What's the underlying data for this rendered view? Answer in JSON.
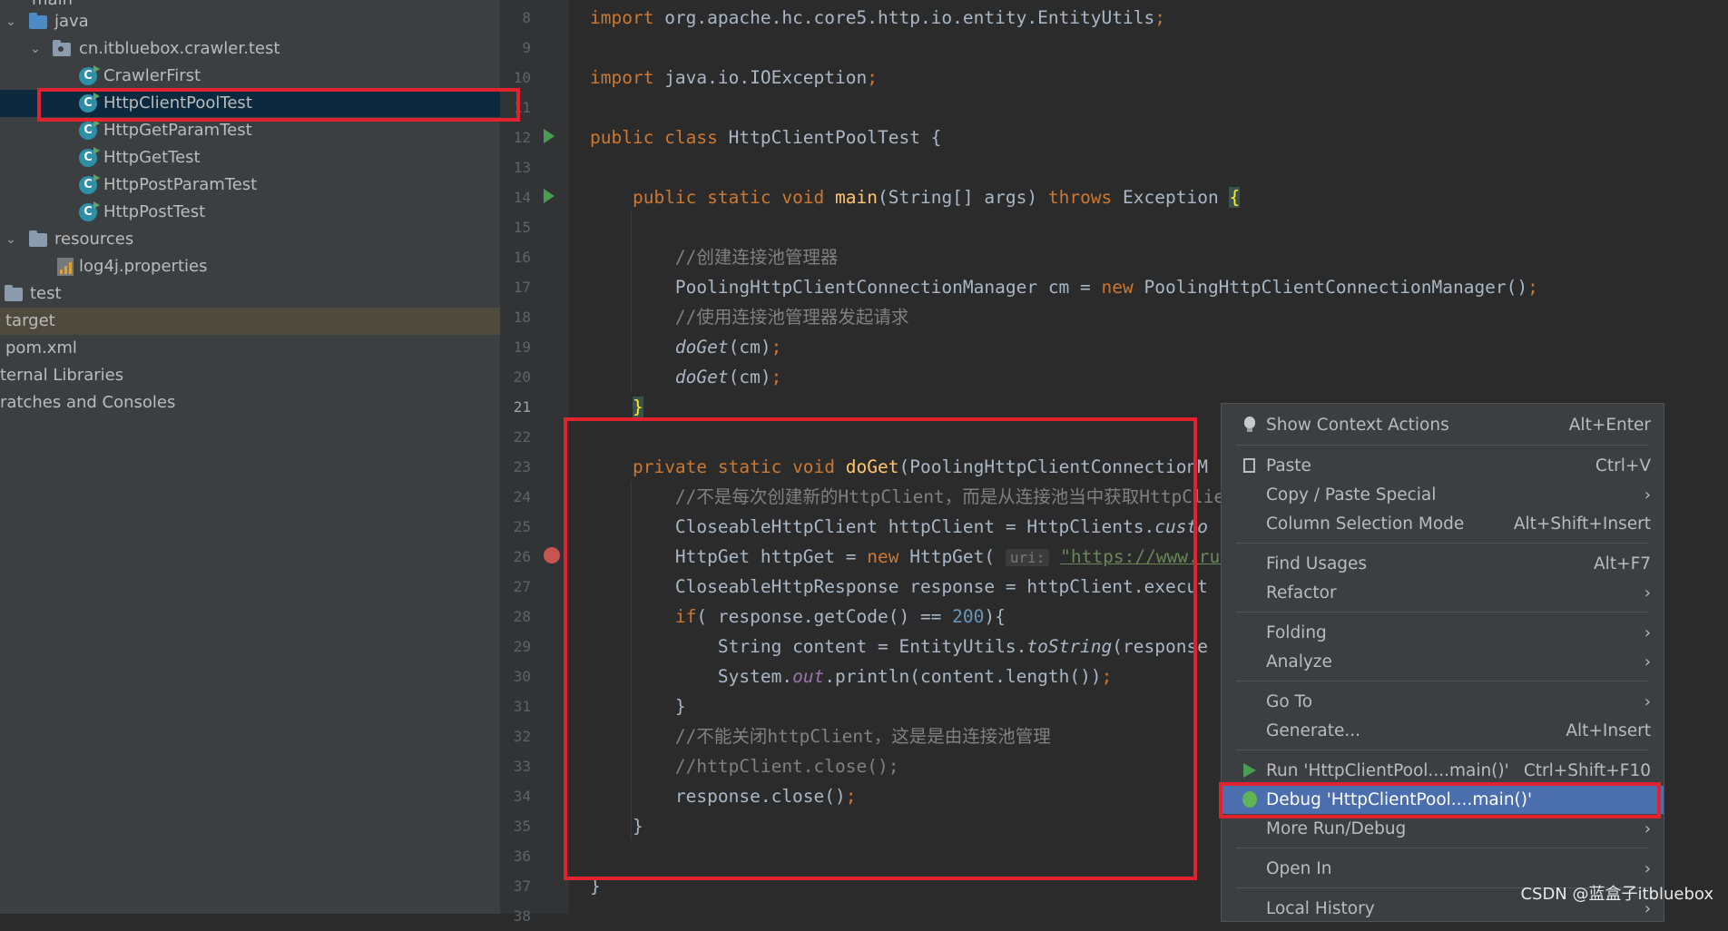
{
  "project_tree": {
    "items": [
      {
        "label": "main"
      },
      {
        "label": "java"
      },
      {
        "label": "cn.itbluebox.crawler.test"
      },
      {
        "label": "CrawlerFirst"
      },
      {
        "label": "HttpClientPoolTest"
      },
      {
        "label": "HttpGetParamTest"
      },
      {
        "label": "HttpGetTest"
      },
      {
        "label": "HttpPostParamTest"
      },
      {
        "label": "HttpPostTest"
      },
      {
        "label": "resources"
      },
      {
        "label": "log4j.properties"
      },
      {
        "label": "test"
      },
      {
        "label": "target"
      },
      {
        "label": "pom.xml"
      },
      {
        "label": "ternal Libraries"
      },
      {
        "label": "ratches and Consoles"
      }
    ]
  },
  "editor": {
    "line_numbers": [
      "8",
      "9",
      "10",
      "11",
      "12",
      "13",
      "14",
      "15",
      "16",
      "17",
      "18",
      "19",
      "20",
      "21",
      "22",
      "23",
      "24",
      "25",
      "26",
      "27",
      "28",
      "29",
      "30",
      "31",
      "32",
      "33",
      "34",
      "35",
      "36",
      "37",
      "38"
    ],
    "current_line": "21",
    "breakpoint_line": "26",
    "code": {
      "l8": {
        "kw": "import ",
        "rest": "org.apache.hc.core5.http.io.entity.EntityUtils",
        "semi": ";"
      },
      "l10": {
        "kw": "import ",
        "rest": "java.io.IOException",
        "semi": ";"
      },
      "l12": {
        "kw": "public class ",
        "rest": "HttpClientPoolTest {"
      },
      "l14": {
        "kw1": "public static void ",
        "fn": "main",
        "mid": "(String[] args) ",
        "kw2": "throws ",
        "rest": "Exception ",
        "brace": "{"
      },
      "l16": {
        "comment": "//创建连接池管理器"
      },
      "l17": {
        "a": "PoolingHttpClientConnectionManager cm = ",
        "kw": "new ",
        "b": "PoolingHttpClientConnectionManager()",
        "semi": ";"
      },
      "l18": {
        "comment": "//使用连接池管理器发起请求"
      },
      "l19": {
        "fn": "doGet",
        "rest": "(cm)",
        "semi": ";"
      },
      "l20": {
        "fn": "doGet",
        "rest": "(cm)",
        "semi": ";"
      },
      "l21": {
        "brace": "}"
      },
      "l23": {
        "kw": "private static void ",
        "fn": "doGet",
        "rest": "(PoolingHttpClientConnectionM"
      },
      "l24": {
        "comment": "//不是每次创建新的HttpClient，而是从连接池当中获取HttpClie"
      },
      "l25": {
        "a": "CloseableHttpClient httpClient = HttpClients.",
        "it": "custo"
      },
      "l26": {
        "a": "HttpGet httpGet = ",
        "kw": "new ",
        "b": "HttpGet( ",
        "hint": "uri:",
        "str": "\"https://www.run"
      },
      "l27": {
        "a": "CloseableHttpResponse response = httpClient.execut"
      },
      "l28": {
        "kw": "if",
        "a": "( response.getCode() == ",
        "num": "200",
        "b": "){"
      },
      "l29": {
        "a": "String content = EntityUtils.",
        "it": "toString",
        "b": "(response"
      },
      "l30": {
        "a": "System.",
        "fld": "out",
        "b": ".println(content.length())",
        "semi": ";"
      },
      "l31": {
        "brace": "}"
      },
      "l32": {
        "comment": "//不能关闭httpClient，这是是由连接池管理"
      },
      "l33": {
        "comment": "//httpClient.close();"
      },
      "l34": {
        "a": "response.close()",
        "semi": ";"
      },
      "l35": {
        "brace": "}"
      },
      "l37": {
        "brace": "}"
      }
    }
  },
  "context_menu": {
    "items": [
      {
        "label": "Show Context Actions",
        "shortcut": "Alt+Enter",
        "icon": "lightbulb-icon"
      },
      {
        "label": "Paste",
        "shortcut": "Ctrl+V",
        "icon": "clipboard-icon"
      },
      {
        "label": "Copy / Paste Special",
        "submenu": "›"
      },
      {
        "label": "Column Selection Mode",
        "shortcut": "Alt+Shift+Insert"
      },
      {
        "label": "Find Usages",
        "shortcut": "Alt+F7"
      },
      {
        "label": "Refactor",
        "submenu": "›"
      },
      {
        "label": "Folding",
        "submenu": "›"
      },
      {
        "label": "Analyze",
        "submenu": "›"
      },
      {
        "label": "Go To",
        "submenu": "›"
      },
      {
        "label": "Generate...",
        "shortcut": "Alt+Insert"
      },
      {
        "label": "Run 'HttpClientPool....main()'",
        "shortcut": "Ctrl+Shift+F10",
        "icon": "run-icon"
      },
      {
        "label": "Debug 'HttpClientPool....main()'",
        "icon": "debug-icon",
        "highlighted": true
      },
      {
        "label": "More Run/Debug",
        "submenu": "›"
      },
      {
        "label": "Open In",
        "submenu": "›"
      },
      {
        "label": "Local History",
        "submenu": "›"
      }
    ]
  },
  "watermark": "CSDN @蓝盒子itbluebox",
  "colors": {
    "sidebar_bg": "#3c3f41",
    "editor_bg": "#2b2b2b",
    "selection_bg": "#0d293e",
    "menu_active": "#4b6eaf",
    "annotation_red": "#e0232e",
    "keyword": "#cc7832",
    "function": "#ffc66d",
    "comment": "#808080"
  }
}
